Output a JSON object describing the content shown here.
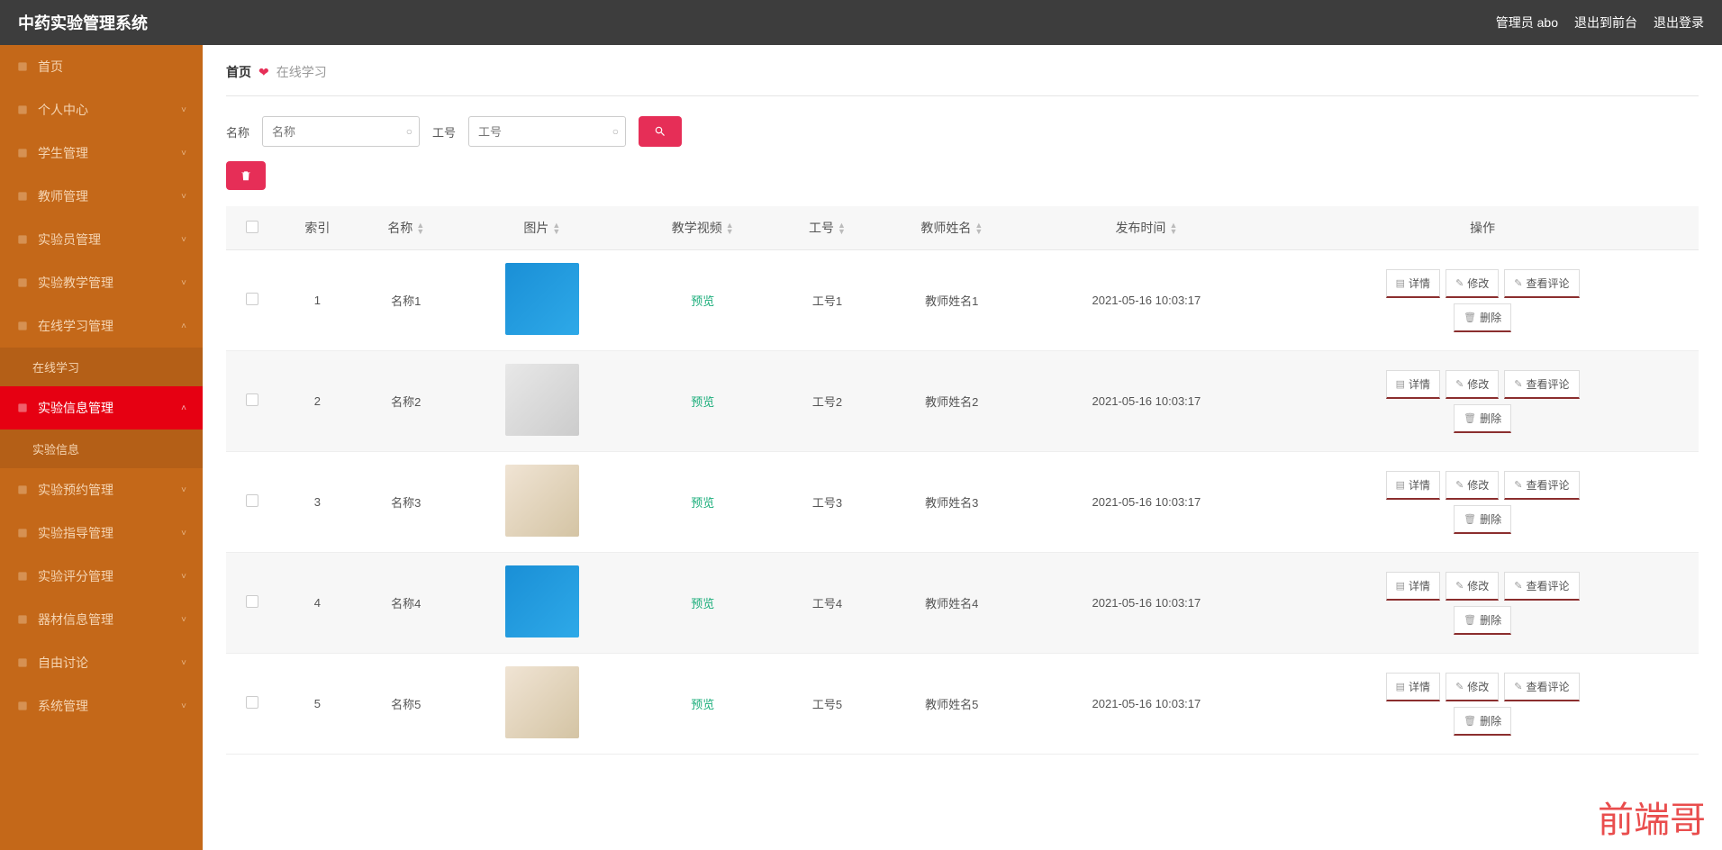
{
  "header": {
    "title": "中药实验管理系统",
    "admin_label": "管理员 abo",
    "logout_front": "退出到前台",
    "logout": "退出登录"
  },
  "sidebar": {
    "items": [
      {
        "label": "首页",
        "icon": "home"
      },
      {
        "label": "个人中心",
        "icon": "user",
        "expandable": true
      },
      {
        "label": "学生管理",
        "icon": "users",
        "expandable": true
      },
      {
        "label": "教师管理",
        "icon": "teacher",
        "expandable": true
      },
      {
        "label": "实验员管理",
        "icon": "chart",
        "expandable": true
      },
      {
        "label": "实验教学管理",
        "icon": "doc",
        "expandable": true
      },
      {
        "label": "在线学习管理",
        "icon": "book",
        "expandable": true,
        "sub": [
          "在线学习"
        ],
        "expanded": true
      },
      {
        "label": "实验信息管理",
        "icon": "gear",
        "expandable": true,
        "active": true,
        "sub": [
          "实验信息"
        ],
        "expanded": true
      },
      {
        "label": "实验预约管理",
        "icon": "mic",
        "expandable": true
      },
      {
        "label": "实验指导管理",
        "icon": "list",
        "expandable": true
      },
      {
        "label": "实验评分管理",
        "icon": "clock",
        "expandable": true
      },
      {
        "label": "器材信息管理",
        "icon": "box",
        "expandable": true
      },
      {
        "label": "自由讨论",
        "icon": "chat",
        "expandable": true
      },
      {
        "label": "系统管理",
        "icon": "menu",
        "expandable": true
      }
    ]
  },
  "breadcrumb": {
    "home": "首页",
    "current": "在线学习"
  },
  "search": {
    "name_label": "名称",
    "name_placeholder": "名称",
    "id_label": "工号",
    "id_placeholder": "工号"
  },
  "table": {
    "headers": {
      "index": "索引",
      "name": "名称",
      "image": "图片",
      "video": "教学视频",
      "workid": "工号",
      "teacher": "教师姓名",
      "publish": "发布时间",
      "action": "操作"
    },
    "preview_label": "预览",
    "actions": {
      "detail": "详情",
      "edit": "修改",
      "comments": "查看评论",
      "delete": "删除"
    },
    "rows": [
      {
        "index": "1",
        "name": "名称1",
        "img_type": "1",
        "workid": "工号1",
        "teacher": "教师姓名1",
        "publish": "2021-05-16 10:03:17"
      },
      {
        "index": "2",
        "name": "名称2",
        "img_type": "2",
        "workid": "工号2",
        "teacher": "教师姓名2",
        "publish": "2021-05-16 10:03:17"
      },
      {
        "index": "3",
        "name": "名称3",
        "img_type": "3",
        "workid": "工号3",
        "teacher": "教师姓名3",
        "publish": "2021-05-16 10:03:17"
      },
      {
        "index": "4",
        "name": "名称4",
        "img_type": "1",
        "workid": "工号4",
        "teacher": "教师姓名4",
        "publish": "2021-05-16 10:03:17"
      },
      {
        "index": "5",
        "name": "名称5",
        "img_type": "3",
        "workid": "工号5",
        "teacher": "教师姓名5",
        "publish": "2021-05-16 10:03:17"
      }
    ]
  },
  "watermark": "前端哥"
}
